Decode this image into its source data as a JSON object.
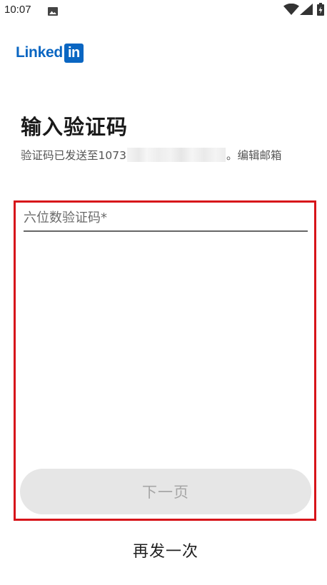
{
  "status_bar": {
    "time": "10:07",
    "icons": [
      "image-icon",
      "wifi-icon",
      "signal-icon",
      "battery-icon"
    ]
  },
  "logo": {
    "text": "Linked",
    "box_text": "in",
    "color": "#0a66c2"
  },
  "page": {
    "title": "输入验证码",
    "subtitle_prefix": "验证码已发送至1073",
    "subtitle_suffix": "。",
    "edit_email_label": "编辑邮箱"
  },
  "form": {
    "code_placeholder": "六位数验证码*",
    "code_value": "",
    "next_label": "下一页",
    "resend_label": "再发一次"
  },
  "colors": {
    "highlight": "#d7141a",
    "button_disabled_bg": "#e6e6e6",
    "button_disabled_text": "#a6a6a6"
  }
}
